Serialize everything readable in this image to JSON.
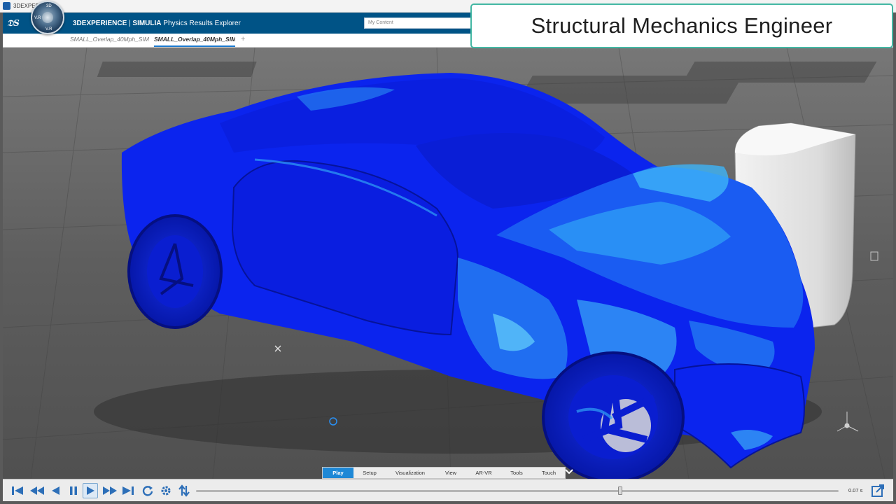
{
  "window": {
    "title": "3DEXPERIENCE"
  },
  "header": {
    "brand": "3DEXPERIENCE",
    "separator": " | ",
    "product": "SIMULIA",
    "app_name": " Physics Results Explorer",
    "search_placeholder": "My Content",
    "compass_labels": {
      "top": "3D",
      "left": "V.R",
      "right": "",
      "bottom": "V.R"
    }
  },
  "tabs": [
    {
      "label": "SMALL_Overlap_40Mph_SIM",
      "active": false
    },
    {
      "label": "SMALL_Overlap_40Mph_SIM",
      "active": true
    }
  ],
  "tab_add": "+",
  "banner": {
    "text": "Structural Mechanics Engineer"
  },
  "menu": {
    "items": [
      {
        "label": "Play",
        "active": true
      },
      {
        "label": "Setup",
        "active": false
      },
      {
        "label": "Visualization",
        "active": false
      },
      {
        "label": "View",
        "active": false
      },
      {
        "label": "AR-VR",
        "active": false
      },
      {
        "label": "Tools",
        "active": false
      },
      {
        "label": "Touch",
        "active": false
      }
    ]
  },
  "playback": {
    "time": "0.07 s",
    "progress": 0.66,
    "buttons": [
      "first-frame",
      "step-back-fast",
      "play-reverse",
      "pause",
      "play",
      "step-forward-fast",
      "last-frame",
      "loop",
      "settings",
      "bounce"
    ]
  },
  "colors": {
    "header": "#005386",
    "banner_border": "#43b7a3",
    "car_base": "#0a22f0",
    "car_stress_light": "#2fa0f5",
    "accent_active": "#1e88d6"
  }
}
